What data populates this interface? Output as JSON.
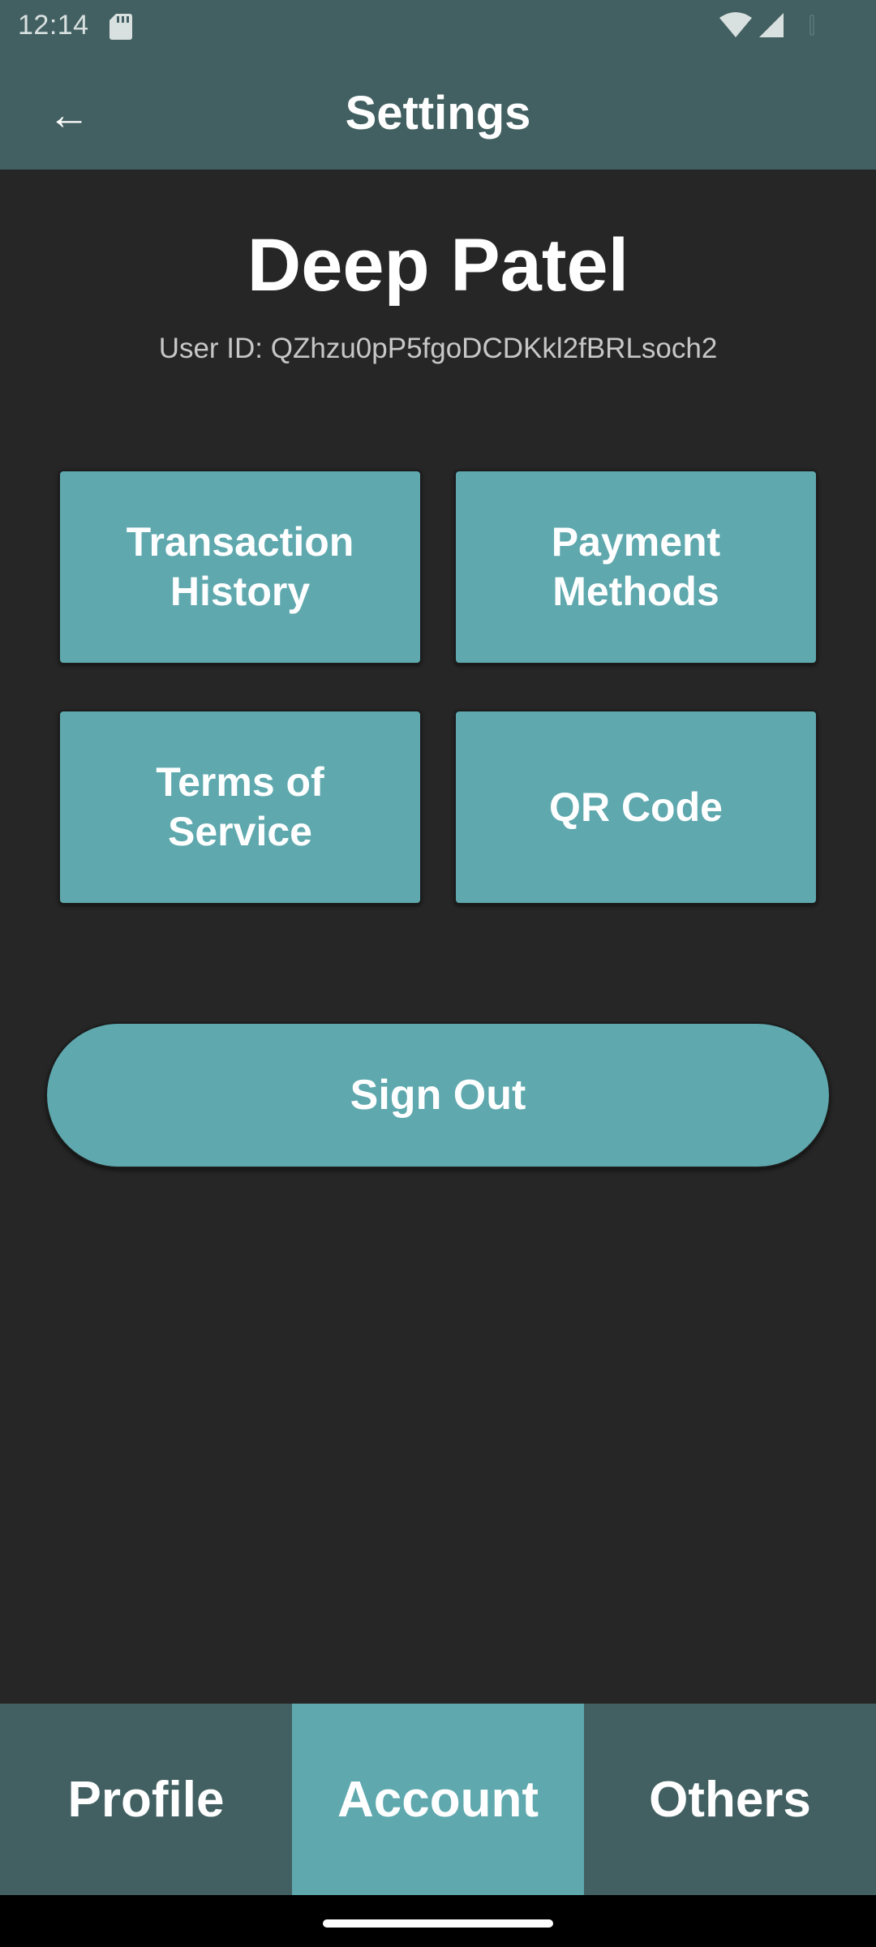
{
  "status_bar": {
    "time": "12:14",
    "icons": [
      "sd-card-icon",
      "wifi-icon",
      "signal-icon",
      "battery-icon"
    ]
  },
  "app_bar": {
    "back_icon": "arrow-left-icon",
    "back_glyph": "←",
    "title": "Settings"
  },
  "profile": {
    "name": "Deep Patel",
    "user_id": "User ID: QZhzu0pP5fgoDCDKkl2fBRLsoch2"
  },
  "tiles": [
    {
      "label": "Transaction\nHistory"
    },
    {
      "label": "Payment\nMethods"
    },
    {
      "label": "Terms of\nService"
    },
    {
      "label": "QR Code"
    }
  ],
  "sign_out_label": "Sign Out",
  "bottom_nav": {
    "tabs": [
      {
        "label": "Profile",
        "active": false
      },
      {
        "label": "Account",
        "active": true
      },
      {
        "label": "Others",
        "active": false
      }
    ]
  },
  "colors": {
    "app_bar": "#426061",
    "background": "#262626",
    "accent": "#5ea8ae",
    "text": "#ffffff"
  }
}
